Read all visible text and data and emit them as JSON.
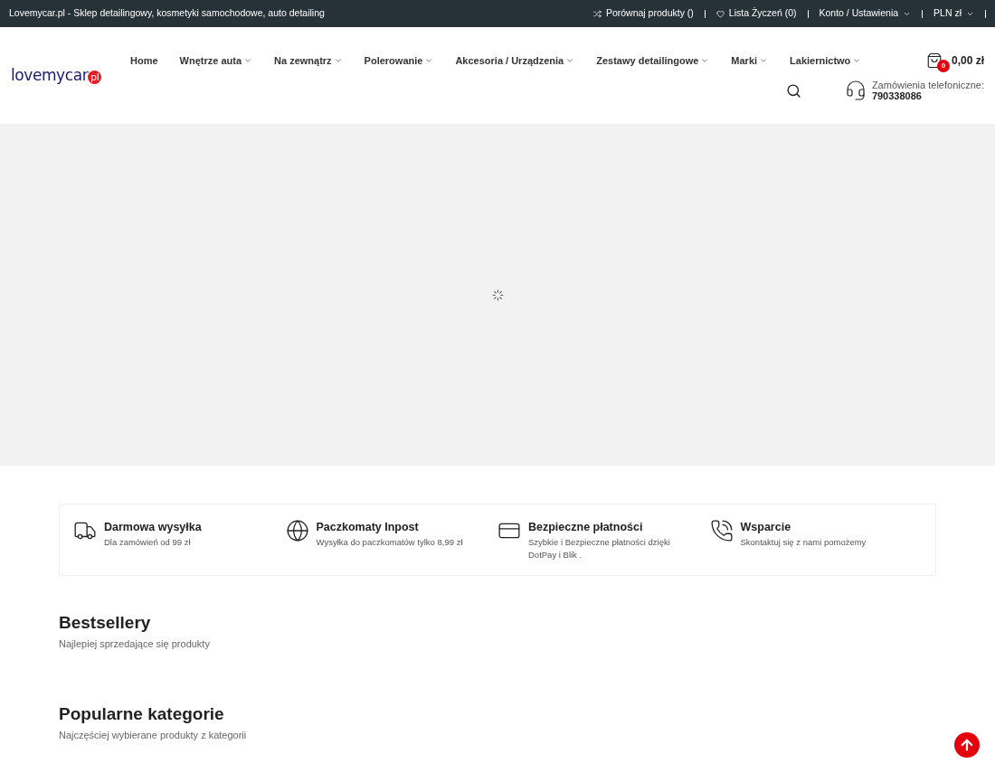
{
  "top_bar": {
    "tagline": "Lovemycar.pl - Sklep detailingowy, kosmetyki samochodowe, auto detailing",
    "links": [
      {
        "kind": "compare",
        "label": "Porównaj produkty ()",
        "has_dropdown": false
      },
      {
        "kind": "wishlist",
        "label": "Lista Życzeń (0)",
        "has_dropdown": false
      },
      {
        "kind": "plain",
        "label": "Konto / Ustawienia",
        "has_dropdown": true
      },
      {
        "kind": "plain",
        "label": "PLN zł",
        "has_dropdown": true
      }
    ]
  },
  "logo": {
    "text": "lovemycar",
    "badge": "pl"
  },
  "nav": [
    {
      "label": "Home",
      "has_dropdown": false
    },
    {
      "label": "Wnętrze auta",
      "has_dropdown": true
    },
    {
      "label": "Na zewnątrz",
      "has_dropdown": true
    },
    {
      "label": "Polerowanie",
      "has_dropdown": true
    },
    {
      "label": "Akcesoria / Urządzenia",
      "has_dropdown": true
    },
    {
      "label": "Zestawy detailingowe",
      "has_dropdown": true
    },
    {
      "label": "Marki",
      "has_dropdown": true
    },
    {
      "label": "Lakiernictwo",
      "has_dropdown": true
    }
  ],
  "cart": {
    "count": "0",
    "total": "0,00 zł"
  },
  "phone": {
    "label": "Zamówienia telefoniczne:",
    "number": "790338086"
  },
  "features": [
    {
      "kind": "truck",
      "title": "Darmowa wysyłka",
      "text": "Dla zamówień od 99 zł"
    },
    {
      "kind": "globe",
      "title": "Paczkomaty Inpost",
      "text": "Wysyłka do paczkomatów tylko 8,99 zł"
    },
    {
      "kind": "payment",
      "title": "Bezpieczne płatności",
      "text": "Szybkie i Bezpieczne płatności dzięki DotPay i Blik ."
    },
    {
      "kind": "support",
      "title": "Wsparcie",
      "text": "Skontaktuj się z nami pomożemy"
    }
  ],
  "sections": [
    {
      "title": "Bestsellery",
      "subtitle": "Najlepiej sprzedające się produkty"
    },
    {
      "title": "Popularne kategorie",
      "subtitle": "Najczęściej wybierane produkty z kategorii"
    }
  ]
}
